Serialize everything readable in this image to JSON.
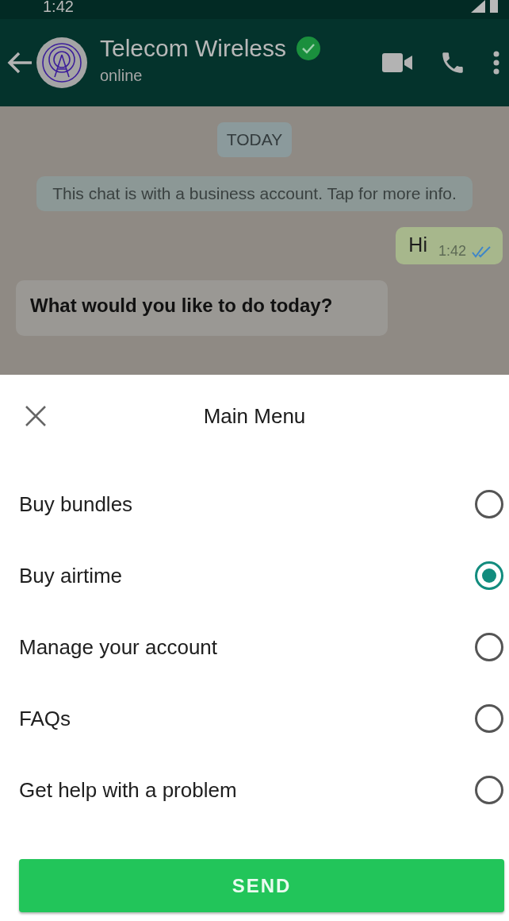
{
  "status_bar": {
    "time": "1:42"
  },
  "header": {
    "title": "Telecom Wireless",
    "subtitle": "online"
  },
  "chat": {
    "date_chip": "TODAY",
    "notice": "This chat is with a business account. Tap for more info.",
    "messages": [
      {
        "kind": "outgoing",
        "text": "Hi",
        "time": "1:42",
        "read": true
      },
      {
        "kind": "incoming",
        "text": "What would you like to do today?"
      }
    ]
  },
  "sheet": {
    "title": "Main Menu",
    "options": [
      {
        "label": "Buy bundles",
        "selected": false
      },
      {
        "label": "Buy airtime",
        "selected": true
      },
      {
        "label": "Manage your account",
        "selected": false
      },
      {
        "label": "FAQs",
        "selected": false
      },
      {
        "label": "Get help with a problem",
        "selected": false
      }
    ],
    "button": "SEND"
  }
}
